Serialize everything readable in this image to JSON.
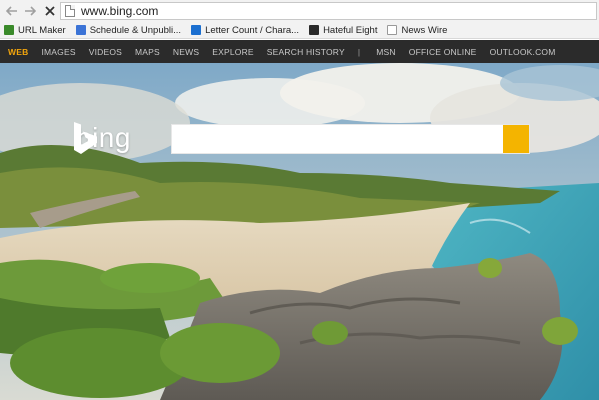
{
  "browser": {
    "url": "www.bing.com"
  },
  "bookmarks": [
    {
      "label": "URL Maker",
      "icon": "sheet-icon"
    },
    {
      "label": "Schedule & Unpubli...",
      "icon": "doc-icon"
    },
    {
      "label": "Letter Count / Chara...",
      "icon": "t-icon"
    },
    {
      "label": "Hateful Eight",
      "icon": "imdb-icon"
    },
    {
      "label": "News Wire",
      "icon": "page-icon"
    }
  ],
  "bing_nav": {
    "items": [
      "WEB",
      "IMAGES",
      "VIDEOS",
      "MAPS",
      "NEWS",
      "EXPLORE",
      "SEARCH HISTORY"
    ],
    "separator": "|",
    "right_items": [
      "MSN",
      "OFFICE ONLINE",
      "OUTLOOK.COM"
    ]
  },
  "logo": {
    "text": "bing"
  },
  "search": {
    "value": "",
    "placeholder": ""
  },
  "colors": {
    "nav_bg": "#2b2b2b",
    "nav_active": "#f2a50d",
    "search_button": "#f4b400"
  }
}
